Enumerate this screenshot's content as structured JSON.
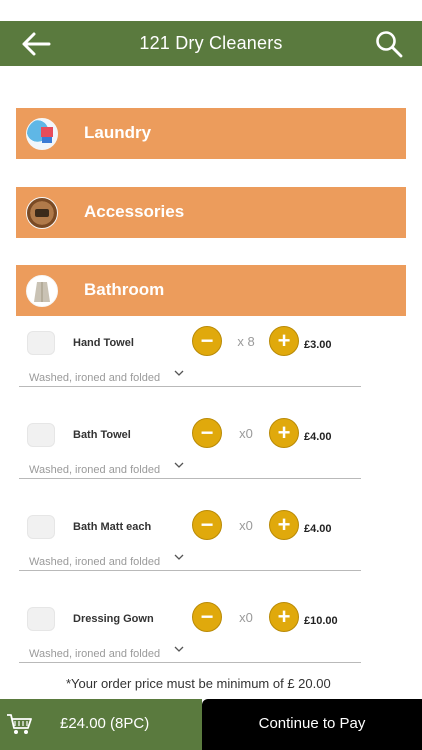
{
  "header": {
    "title": "121 Dry Cleaners",
    "back_icon": "arrow-left-icon",
    "search_icon": "search-icon"
  },
  "categories": [
    {
      "label": "Laundry",
      "icon": "laundry-thumbnail"
    },
    {
      "label": "Accessories",
      "icon": "accessories-thumbnail"
    },
    {
      "label": "Bathroom",
      "icon": "bathroom-thumbnail"
    }
  ],
  "items": [
    {
      "name": "Hand Towel",
      "qty": "x 8",
      "price": "£3.00",
      "service": "Washed, ironed and folded"
    },
    {
      "name": "Bath Towel",
      "qty": "x0",
      "price": "£4.00",
      "service": "Washed, ironed and folded"
    },
    {
      "name": "Bath Matt each",
      "qty": "x0",
      "price": "£4.00",
      "service": "Washed, ironed and folded"
    },
    {
      "name": "Dressing Gown",
      "qty": "x0",
      "price": "£10.00",
      "service": "Washed, ironed and folded"
    }
  ],
  "min_note": "*Your order price must be minimum of £  20.00",
  "footer": {
    "total": "£24.00 (8PC)",
    "pay_label": "Continue to Pay"
  },
  "colors": {
    "header_green": "#5a7a3e",
    "category_orange": "#ec9c5c",
    "button_gold": "#e0a90c",
    "pay_black": "#000000"
  }
}
